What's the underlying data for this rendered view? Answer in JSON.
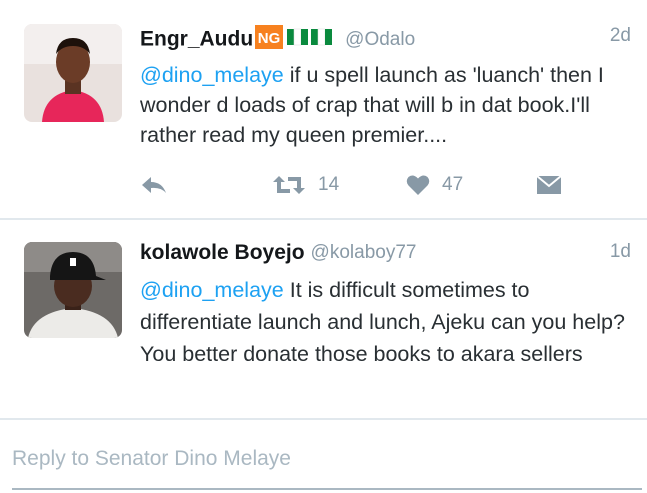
{
  "tweets": [
    {
      "name": "Engr_Audu",
      "badge_text": "NG",
      "handle": "@Odalo",
      "time": "2d",
      "mention": "@dino_melaye",
      "text": " if u spell launch as 'luanch' then I wonder d loads of crap that will b in dat book.I'll rather read my queen premier....",
      "retweets": "14",
      "likes": "47"
    },
    {
      "name": "kolawole Boyejo",
      "handle": "@kolaboy77",
      "time": "1d",
      "mention": "@dino_melaye",
      "text": " It is difficult sometimes to differentiate launch and lunch, Ajeku can you help? You better donate those books to akara sellers"
    }
  ],
  "reply_placeholder": "Reply to Senator Dino Melaye",
  "colors": {
    "link": "#1da1f2",
    "muted": "#8899a6",
    "divider": "#e1e8ed",
    "ng_orange": "#f7811f",
    "ng_green": "#0a8a3e"
  },
  "icons": [
    "reply-icon",
    "retweet-icon",
    "heart-icon",
    "envelope-icon",
    "nigeria-flag-icon"
  ]
}
